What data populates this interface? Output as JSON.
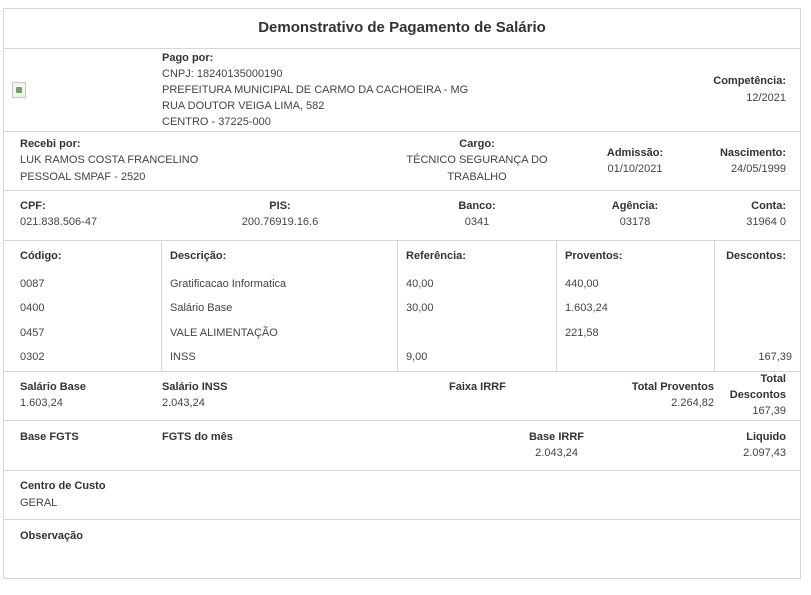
{
  "title": "Demonstrativo de Pagamento de Salário",
  "payer": {
    "label": "Pago por:",
    "cnpj": "CNPJ: 18240135000190",
    "name": "PREFEITURA MUNICIPAL DE CARMO DA CACHOEIRA - MG",
    "street": "RUA DOUTOR VEIGA LIMA, 582",
    "district": "CENTRO - 37225-000",
    "logo_icon": "broken-image-icon"
  },
  "competencia": {
    "label": "Competência:",
    "value": "12/2021"
  },
  "employee": {
    "label": "Recebi por:",
    "name": "LUK RAMOS COSTA FRANCELINO",
    "unit": "PESSOAL SMPAF - 2520",
    "cargo_label": "Cargo:",
    "cargo_line1": "TÉCNICO SEGURANÇA DO",
    "cargo_line2": "TRABALHO",
    "admissao_label": "Admissão:",
    "admissao": "01/10/2021",
    "nascimento_label": "Nascimento:",
    "nascimento": "24/05/1999"
  },
  "docs": {
    "cpf_label": "CPF:",
    "cpf": "021.838.506-47",
    "pis_label": "PIS:",
    "pis": "200.76919.16.6",
    "banco_label": "Banco:",
    "banco": "0341",
    "agencia_label": "Agência:",
    "agencia": "03178",
    "conta_label": "Conta:",
    "conta": "31964 0"
  },
  "table": {
    "headers": [
      "Código:",
      "Descrição:",
      "Referência:",
      "Proventos:",
      "Descontos:"
    ],
    "rows": [
      {
        "codigo": "0087",
        "descricao": "Gratificacao Informatica",
        "referencia": "40,00",
        "proventos": "440,00",
        "descontos": ""
      },
      {
        "codigo": "0400",
        "descricao": "Salário Base",
        "referencia": "30,00",
        "proventos": "1.603,24",
        "descontos": ""
      },
      {
        "codigo": "0457",
        "descricao": "VALE ALIMENTAÇÃO",
        "referencia": "",
        "proventos": "221,58",
        "descontos": ""
      },
      {
        "codigo": "0302",
        "descricao": "INSS",
        "referencia": "9,00",
        "proventos": "",
        "descontos": "167,39"
      }
    ]
  },
  "totals": {
    "salario_base_label": "Salário Base",
    "salario_base": "1.603,24",
    "salario_inss_label": "Salário INSS",
    "salario_inss": "2.043,24",
    "faixa_irrf_label": "Faixa IRRF",
    "total_proventos_label": "Total Proventos",
    "total_proventos": "2.264,82",
    "total_descontos_label1": "Total",
    "total_descontos_label2": "Descontos",
    "total_descontos": "167,39"
  },
  "fgts": {
    "base_fgts_label": "Base FGTS",
    "fgts_mes_label": "FGTS do mês",
    "base_irrf_label": "Base IRRF",
    "base_irrf": "2.043,24",
    "liquido_label": "Liquido",
    "liquido": "2.097,43"
  },
  "centro": {
    "label": "Centro de Custo",
    "value": "GERAL"
  },
  "observacao": {
    "label": "Observação"
  }
}
